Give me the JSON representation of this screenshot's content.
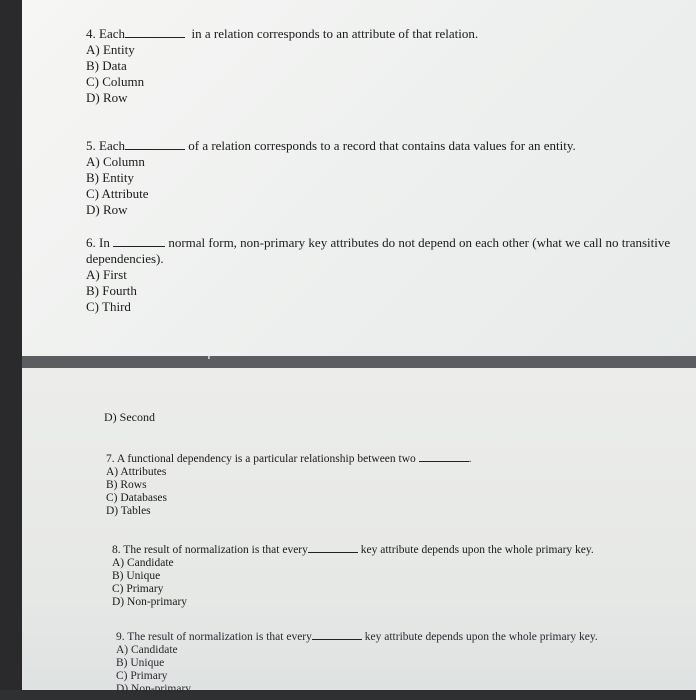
{
  "questions": [
    {
      "number": "4.",
      "pre": "Each",
      "post": "in a relation corresponds to an attribute of that relation.",
      "options": [
        "A) Entity",
        "B) Data",
        "C) Column",
        "D) Row"
      ]
    },
    {
      "number": "5.",
      "pre": "Each",
      "post": "of a relation corresponds to a record that contains data values for an entity.",
      "options": [
        "A) Column",
        "B) Entity",
        "C) Attribute",
        "D) Row"
      ]
    },
    {
      "number": "6.",
      "pre": "In",
      "post": "normal form, non-primary key attributes do not depend on each other (what we call no transitive",
      "line2": "dependencies).",
      "options": [
        "A) First",
        "B) Fourth",
        "C) Third"
      ]
    },
    {
      "continued_option": "D) Second"
    },
    {
      "number": "7.",
      "pre": "A functional dependency is a particular relationship between two",
      "post": ".",
      "options": [
        "A) Attributes",
        "B) Rows",
        "C) Databases",
        "D) Tables"
      ]
    },
    {
      "number": "8.",
      "pre": "The result of normalization is that every",
      "post": "key attribute depends upon the whole primary key.",
      "options": [
        "A) Candidate",
        "B) Unique",
        "C) Primary",
        "D) Non-primary"
      ]
    },
    {
      "number": "9.",
      "pre": "The result of normalization is that every",
      "post": "key attribute depends upon the whole primary key.",
      "options": [
        "A) Candidate",
        "B) Unique",
        "C) Primary",
        "D) Non-primary"
      ]
    }
  ],
  "cursor_icon": "text-cursor-icon"
}
